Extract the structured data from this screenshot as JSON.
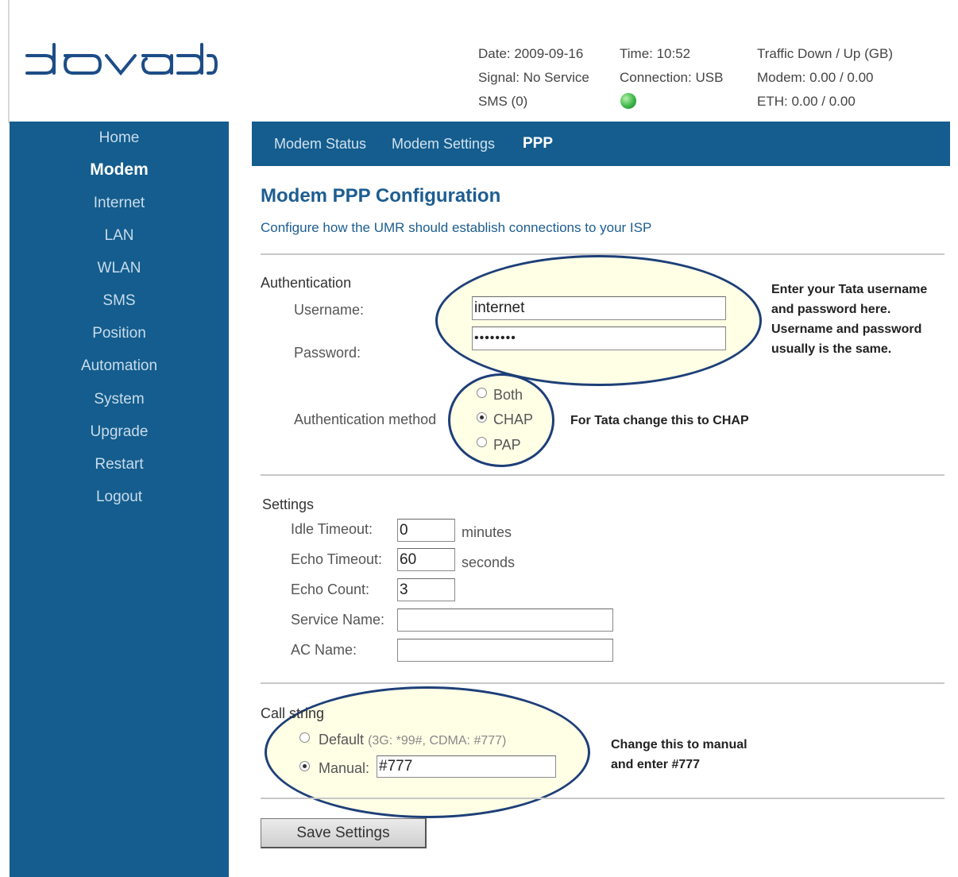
{
  "brand": {
    "logo_text": "dovado"
  },
  "status": {
    "date": "Date: 2009-09-16",
    "signal": "Signal: No Service",
    "sms": "SMS (0)",
    "time": "Time: 10:52",
    "connection": "Connection: USB",
    "connection_indicator_color": "#3cb64a",
    "traffic_title": "Traffic Down / Up (GB)",
    "modem_traffic": "Modem: 0.00 / 0.00",
    "eth_traffic": "ETH: 0.00 / 0.00"
  },
  "sidebar": {
    "items": [
      {
        "label": "Home",
        "active": false
      },
      {
        "label": "Modem",
        "active": true
      },
      {
        "label": "Internet",
        "active": false
      },
      {
        "label": "LAN",
        "active": false
      },
      {
        "label": "WLAN",
        "active": false
      },
      {
        "label": "SMS",
        "active": false
      },
      {
        "label": "Position",
        "active": false
      },
      {
        "label": "Automation",
        "active": false
      },
      {
        "label": "System",
        "active": false
      },
      {
        "label": "Upgrade",
        "active": false
      },
      {
        "label": "Restart",
        "active": false
      },
      {
        "label": "Logout",
        "active": false
      }
    ]
  },
  "tabs": [
    {
      "label": "Modem Status",
      "active": false
    },
    {
      "label": "Modem Settings",
      "active": false
    },
    {
      "label": "PPP",
      "active": true
    }
  ],
  "page": {
    "title": "Modem PPP Configuration",
    "subtitle": "Configure how the UMR should establish connections to your ISP"
  },
  "authentication": {
    "section_label": "Authentication",
    "username_label": "Username:",
    "username_value": "internet",
    "password_label": "Password:",
    "password_value": "••••••••",
    "method_label": "Authentication method",
    "options": [
      "Both",
      "CHAP",
      "PAP"
    ],
    "selected": "CHAP"
  },
  "settings": {
    "section_label": "Settings",
    "idle_timeout_label": "Idle Timeout:",
    "idle_timeout_value": "0",
    "idle_timeout_unit": "minutes",
    "echo_timeout_label": "Echo Timeout:",
    "echo_timeout_value": "60",
    "echo_timeout_unit": "seconds",
    "echo_count_label": "Echo Count:",
    "echo_count_value": "3",
    "service_name_label": "Service Name:",
    "service_name_value": "",
    "ac_name_label": "AC Name:",
    "ac_name_value": ""
  },
  "call_string": {
    "section_label": "Call string",
    "default_label": "Default",
    "default_hint": "(3G: *99#, CDMA: #777)",
    "manual_label": "Manual:",
    "manual_value": "#777",
    "selected": "Manual"
  },
  "save_label": "Save Settings",
  "annotations": {
    "credentials": [
      "Enter your Tata username",
      "and password here.",
      "Username and password",
      "usually is the same."
    ],
    "method": "For Tata change this to CHAP",
    "call_string": [
      "Change this to manual",
      "and enter #777"
    ],
    "highlight_color": "#1d3f78"
  }
}
